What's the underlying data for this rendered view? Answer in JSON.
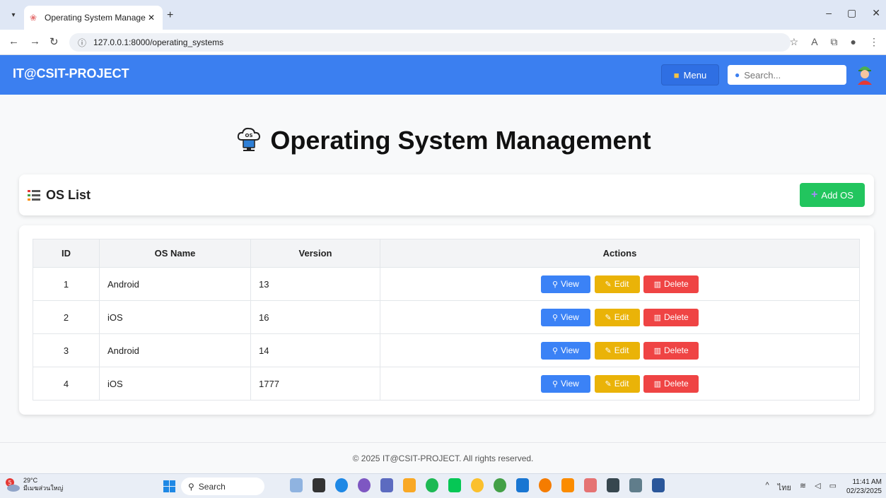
{
  "browser": {
    "tab_title": "Operating System Managemen",
    "url": "127.0.0.1:8000/operating_systems"
  },
  "navbar": {
    "brand": "IT@CSIT-PROJECT",
    "menu_label": "Menu",
    "search_placeholder": "Search..."
  },
  "page": {
    "title": "Operating System Management"
  },
  "list": {
    "title": "OS List",
    "add_label": "Add OS"
  },
  "table": {
    "headers": [
      "ID",
      "OS Name",
      "Version",
      "Actions"
    ],
    "rows": [
      {
        "id": "1",
        "name": "Android",
        "version": "13"
      },
      {
        "id": "2",
        "name": "iOS",
        "version": "16"
      },
      {
        "id": "3",
        "name": "Android",
        "version": "14"
      },
      {
        "id": "4",
        "name": "iOS",
        "version": "1777"
      }
    ],
    "actions": {
      "view": "View",
      "edit": "Edit",
      "delete": "Delete"
    }
  },
  "footer": {
    "text": "© 2025 IT@CSIT-PROJECT. All rights reserved."
  },
  "taskbar": {
    "weather_badge": "5",
    "temperature": "29°C",
    "weather_desc": "มีเมฆส่วนใหญ่",
    "search_label": "Search",
    "lang": "ไทย",
    "time": "11:41 AM",
    "date": "02/23/2025"
  },
  "colors": {
    "navbar": "#3b7ff0",
    "add_button": "#22c55e",
    "view_button": "#3b82f6",
    "edit_button": "#eab308",
    "delete_button": "#ef4444"
  }
}
